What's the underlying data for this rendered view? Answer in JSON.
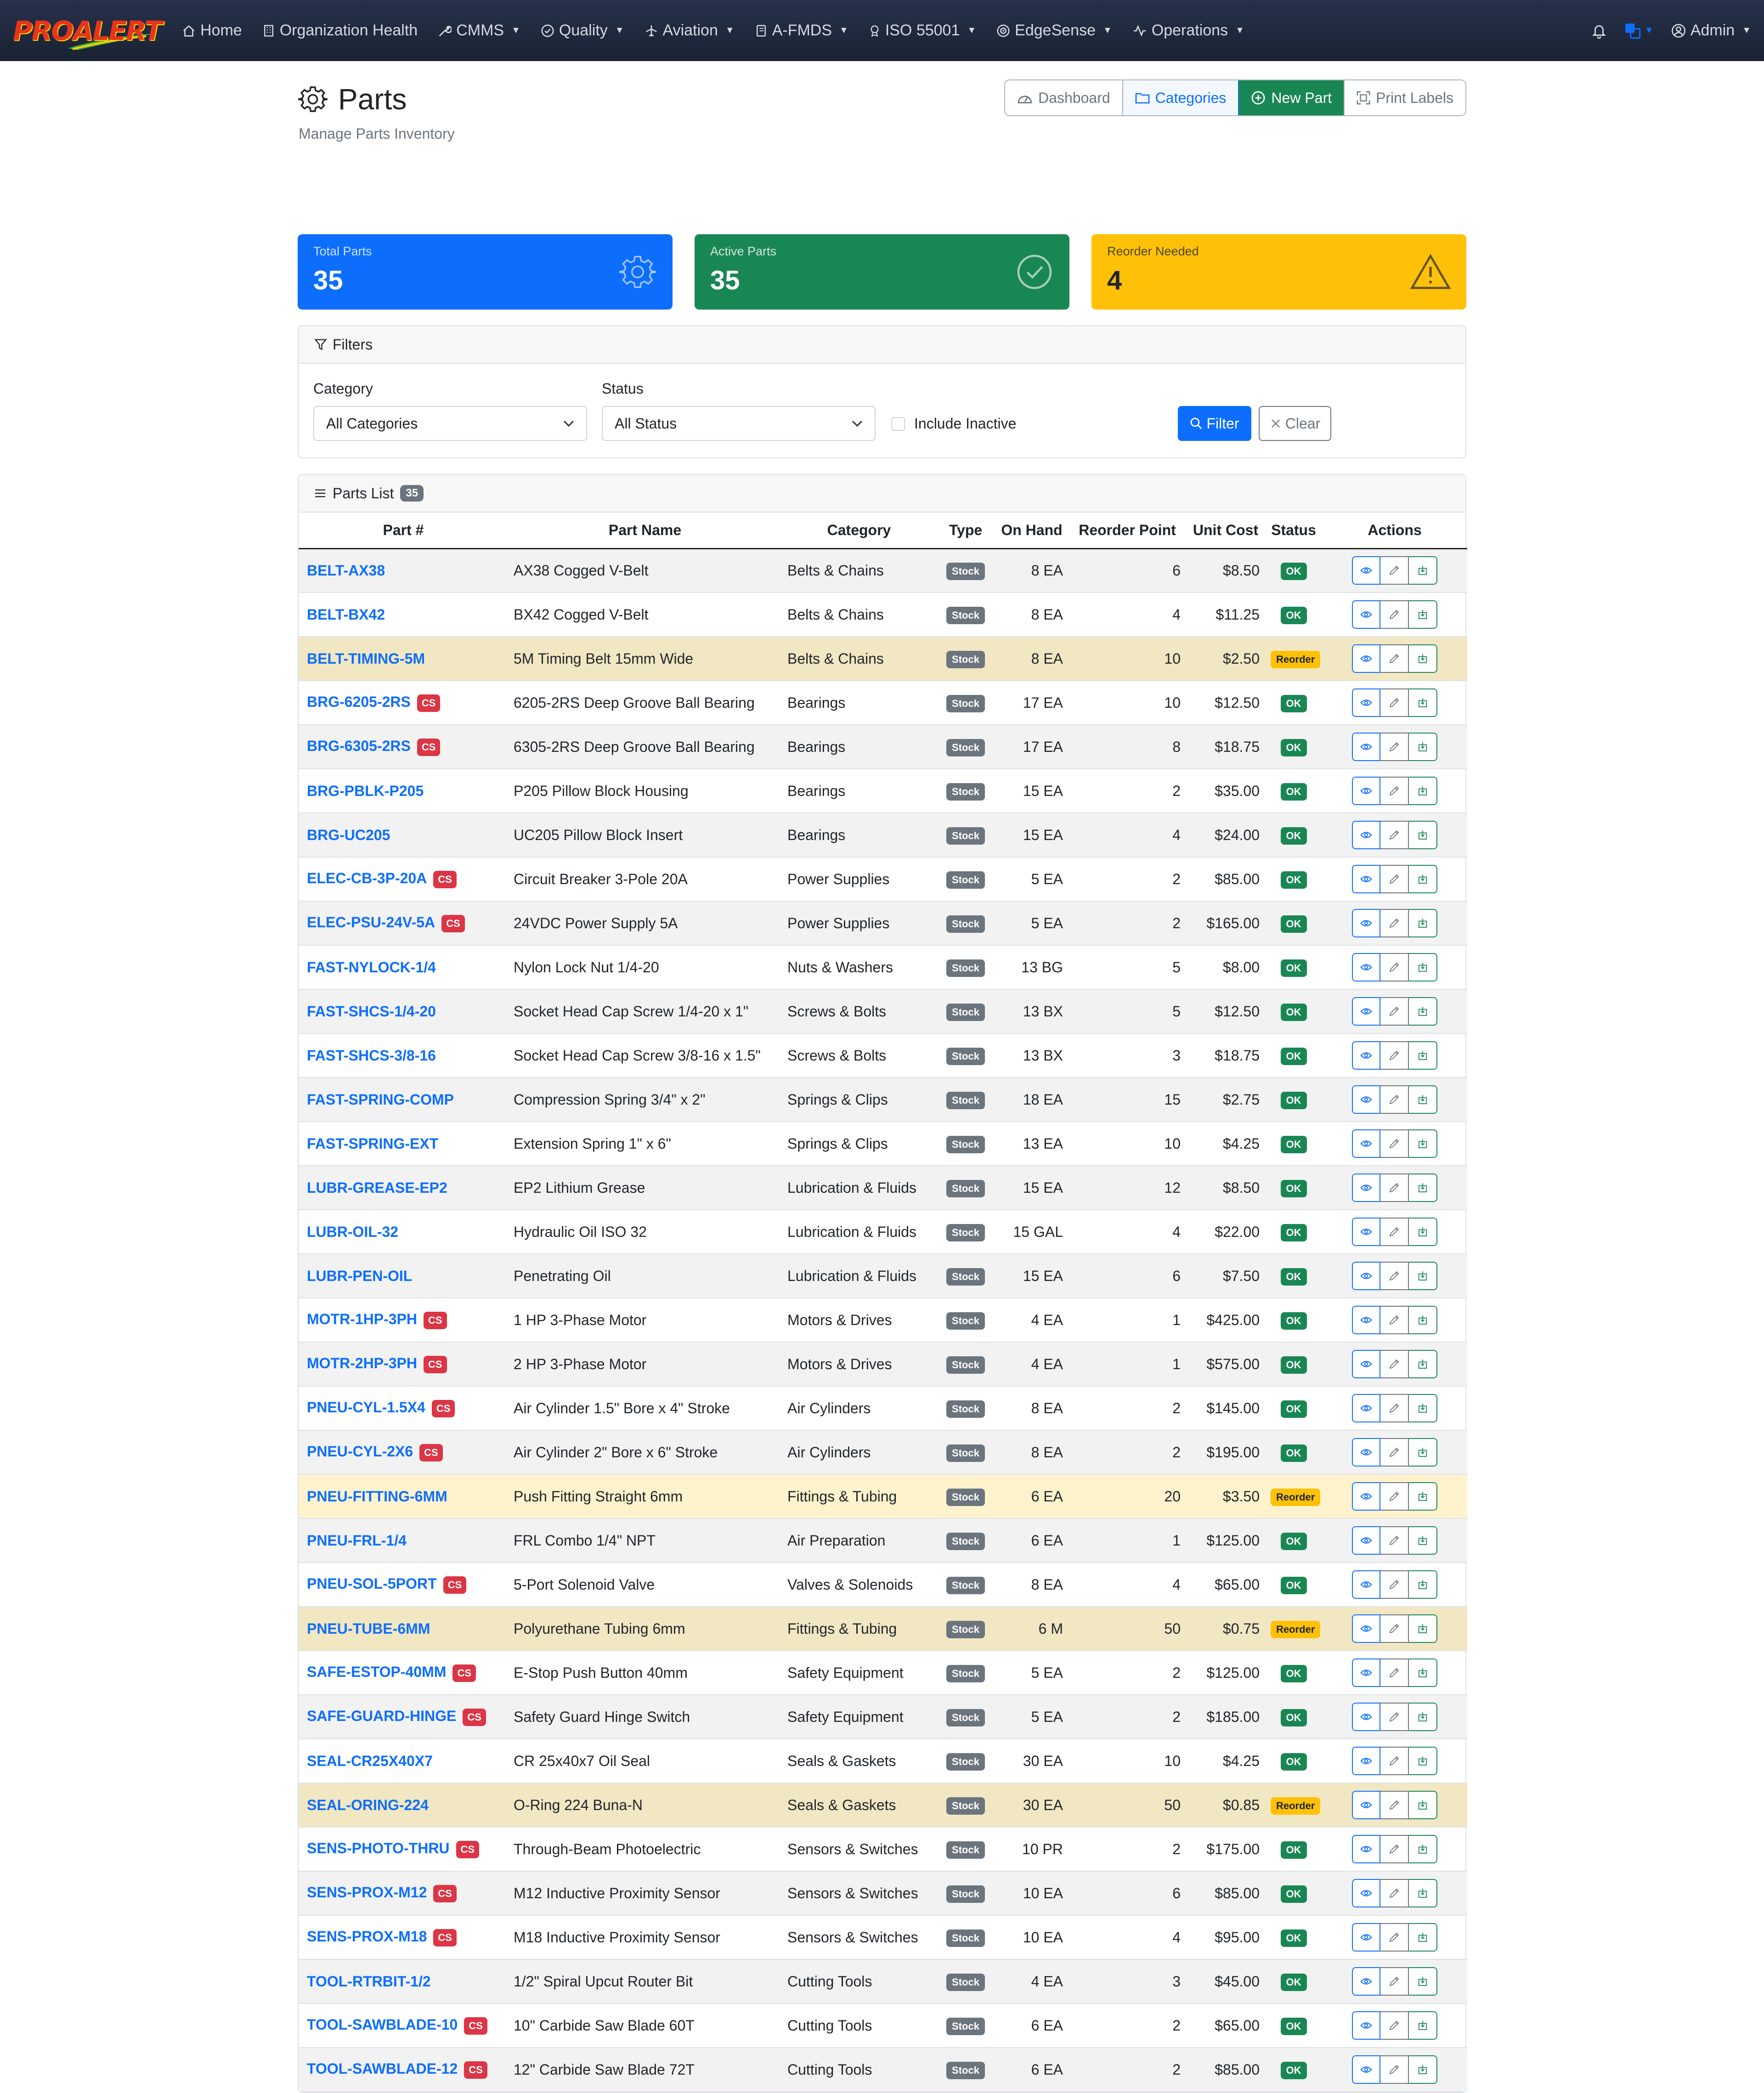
{
  "brand": {
    "name": "PROALERT"
  },
  "nav": {
    "items": [
      {
        "label": "Home",
        "icon": "house-icon",
        "dropdown": false
      },
      {
        "label": "Organization Health",
        "icon": "building-icon",
        "dropdown": false
      },
      {
        "label": "CMMS",
        "icon": "wrench-icon",
        "dropdown": true
      },
      {
        "label": "Quality",
        "icon": "check-circle-icon",
        "dropdown": true
      },
      {
        "label": "Aviation",
        "icon": "airplane-icon",
        "dropdown": true
      },
      {
        "label": "A-FMDS",
        "icon": "journal-icon",
        "dropdown": true
      },
      {
        "label": "ISO 55001",
        "icon": "award-icon",
        "dropdown": true
      },
      {
        "label": "EdgeSense",
        "icon": "broadcast-icon",
        "dropdown": true
      },
      {
        "label": "Operations",
        "icon": "activity-icon",
        "dropdown": true
      }
    ],
    "user_label": "Admin"
  },
  "page": {
    "title": "Parts",
    "subtitle": "Manage Parts Inventory",
    "buttons": {
      "dashboard": "Dashboard",
      "categories": "Categories",
      "new_part": "New Part",
      "print_labels": "Print Labels"
    }
  },
  "stats": {
    "total": {
      "label": "Total Parts",
      "value": "35"
    },
    "active": {
      "label": "Active Parts",
      "value": "35"
    },
    "reorder": {
      "label": "Reorder Needed",
      "value": "4"
    }
  },
  "filters": {
    "title": "Filters",
    "category_label": "Category",
    "category_value": "All Categories",
    "status_label": "Status",
    "status_value": "All Status",
    "include_inactive": "Include Inactive",
    "filter_btn": "Filter",
    "clear_btn": "Clear"
  },
  "parts_list": {
    "title": "Parts List",
    "count": "35",
    "columns": [
      "Part #",
      "Part Name",
      "Category",
      "Type",
      "On Hand",
      "Reorder Point",
      "Unit Cost",
      "Status",
      "Actions"
    ],
    "rows": [
      {
        "num": "BELT-AX38",
        "cs": false,
        "name": "AX38 Cogged V-Belt",
        "category": "Belts & Chains",
        "type": "Stock",
        "on_hand": "8 EA",
        "reorder": "6",
        "cost": "$8.50",
        "status": "OK"
      },
      {
        "num": "BELT-BX42",
        "cs": false,
        "name": "BX42 Cogged V-Belt",
        "category": "Belts & Chains",
        "type": "Stock",
        "on_hand": "8 EA",
        "reorder": "4",
        "cost": "$11.25",
        "status": "OK"
      },
      {
        "num": "BELT-TIMING-5M",
        "cs": false,
        "name": "5M Timing Belt 15mm Wide",
        "category": "Belts & Chains",
        "type": "Stock",
        "on_hand": "8 EA",
        "reorder": "10",
        "cost": "$2.50",
        "status": "Reorder"
      },
      {
        "num": "BRG-6205-2RS",
        "cs": true,
        "name": "6205-2RS Deep Groove Ball Bearing",
        "category": "Bearings",
        "type": "Stock",
        "on_hand": "17 EA",
        "reorder": "10",
        "cost": "$12.50",
        "status": "OK"
      },
      {
        "num": "BRG-6305-2RS",
        "cs": true,
        "name": "6305-2RS Deep Groove Ball Bearing",
        "category": "Bearings",
        "type": "Stock",
        "on_hand": "17 EA",
        "reorder": "8",
        "cost": "$18.75",
        "status": "OK"
      },
      {
        "num": "BRG-PBLK-P205",
        "cs": false,
        "name": "P205 Pillow Block Housing",
        "category": "Bearings",
        "type": "Stock",
        "on_hand": "15 EA",
        "reorder": "2",
        "cost": "$35.00",
        "status": "OK"
      },
      {
        "num": "BRG-UC205",
        "cs": false,
        "name": "UC205 Pillow Block Insert",
        "category": "Bearings",
        "type": "Stock",
        "on_hand": "15 EA",
        "reorder": "4",
        "cost": "$24.00",
        "status": "OK"
      },
      {
        "num": "ELEC-CB-3P-20A",
        "cs": true,
        "name": "Circuit Breaker 3-Pole 20A",
        "category": "Power Supplies",
        "type": "Stock",
        "on_hand": "5 EA",
        "reorder": "2",
        "cost": "$85.00",
        "status": "OK"
      },
      {
        "num": "ELEC-PSU-24V-5A",
        "cs": true,
        "name": "24VDC Power Supply 5A",
        "category": "Power Supplies",
        "type": "Stock",
        "on_hand": "5 EA",
        "reorder": "2",
        "cost": "$165.00",
        "status": "OK"
      },
      {
        "num": "FAST-NYLOCK-1/4",
        "cs": false,
        "name": "Nylon Lock Nut 1/4-20",
        "category": "Nuts & Washers",
        "type": "Stock",
        "on_hand": "13 BG",
        "reorder": "5",
        "cost": "$8.00",
        "status": "OK"
      },
      {
        "num": "FAST-SHCS-1/4-20",
        "cs": false,
        "name": "Socket Head Cap Screw 1/4-20 x 1\"",
        "category": "Screws & Bolts",
        "type": "Stock",
        "on_hand": "13 BX",
        "reorder": "5",
        "cost": "$12.50",
        "status": "OK"
      },
      {
        "num": "FAST-SHCS-3/8-16",
        "cs": false,
        "name": "Socket Head Cap Screw 3/8-16 x 1.5\"",
        "category": "Screws & Bolts",
        "type": "Stock",
        "on_hand": "13 BX",
        "reorder": "3",
        "cost": "$18.75",
        "status": "OK"
      },
      {
        "num": "FAST-SPRING-COMP",
        "cs": false,
        "name": "Compression Spring 3/4\" x 2\"",
        "category": "Springs & Clips",
        "type": "Stock",
        "on_hand": "18 EA",
        "reorder": "15",
        "cost": "$2.75",
        "status": "OK"
      },
      {
        "num": "FAST-SPRING-EXT",
        "cs": false,
        "name": "Extension Spring 1\" x 6\"",
        "category": "Springs & Clips",
        "type": "Stock",
        "on_hand": "13 EA",
        "reorder": "10",
        "cost": "$4.25",
        "status": "OK"
      },
      {
        "num": "LUBR-GREASE-EP2",
        "cs": false,
        "name": "EP2 Lithium Grease",
        "category": "Lubrication & Fluids",
        "type": "Stock",
        "on_hand": "15 EA",
        "reorder": "12",
        "cost": "$8.50",
        "status": "OK"
      },
      {
        "num": "LUBR-OIL-32",
        "cs": false,
        "name": "Hydraulic Oil ISO 32",
        "category": "Lubrication & Fluids",
        "type": "Stock",
        "on_hand": "15 GAL",
        "reorder": "4",
        "cost": "$22.00",
        "status": "OK"
      },
      {
        "num": "LUBR-PEN-OIL",
        "cs": false,
        "name": "Penetrating Oil",
        "category": "Lubrication & Fluids",
        "type": "Stock",
        "on_hand": "15 EA",
        "reorder": "6",
        "cost": "$7.50",
        "status": "OK"
      },
      {
        "num": "MOTR-1HP-3PH",
        "cs": true,
        "name": "1 HP 3-Phase Motor",
        "category": "Motors & Drives",
        "type": "Stock",
        "on_hand": "4 EA",
        "reorder": "1",
        "cost": "$425.00",
        "status": "OK"
      },
      {
        "num": "MOTR-2HP-3PH",
        "cs": true,
        "name": "2 HP 3-Phase Motor",
        "category": "Motors & Drives",
        "type": "Stock",
        "on_hand": "4 EA",
        "reorder": "1",
        "cost": "$575.00",
        "status": "OK"
      },
      {
        "num": "PNEU-CYL-1.5X4",
        "cs": true,
        "name": "Air Cylinder 1.5\" Bore x 4\" Stroke",
        "category": "Air Cylinders",
        "type": "Stock",
        "on_hand": "8 EA",
        "reorder": "2",
        "cost": "$145.00",
        "status": "OK"
      },
      {
        "num": "PNEU-CYL-2X6",
        "cs": true,
        "name": "Air Cylinder 2\" Bore x 6\" Stroke",
        "category": "Air Cylinders",
        "type": "Stock",
        "on_hand": "8 EA",
        "reorder": "2",
        "cost": "$195.00",
        "status": "OK"
      },
      {
        "num": "PNEU-FITTING-6MM",
        "cs": false,
        "name": "Push Fitting Straight 6mm",
        "category": "Fittings & Tubing",
        "type": "Stock",
        "on_hand": "6 EA",
        "reorder": "20",
        "cost": "$3.50",
        "status": "Reorder"
      },
      {
        "num": "PNEU-FRL-1/4",
        "cs": false,
        "name": "FRL Combo 1/4\" NPT",
        "category": "Air Preparation",
        "type": "Stock",
        "on_hand": "6 EA",
        "reorder": "1",
        "cost": "$125.00",
        "status": "OK"
      },
      {
        "num": "PNEU-SOL-5PORT",
        "cs": true,
        "name": "5-Port Solenoid Valve",
        "category": "Valves & Solenoids",
        "type": "Stock",
        "on_hand": "8 EA",
        "reorder": "4",
        "cost": "$65.00",
        "status": "OK"
      },
      {
        "num": "PNEU-TUBE-6MM",
        "cs": false,
        "name": "Polyurethane Tubing 6mm",
        "category": "Fittings & Tubing",
        "type": "Stock",
        "on_hand": "6 M",
        "reorder": "50",
        "cost": "$0.75",
        "status": "Reorder"
      },
      {
        "num": "SAFE-ESTOP-40MM",
        "cs": true,
        "name": "E-Stop Push Button 40mm",
        "category": "Safety Equipment",
        "type": "Stock",
        "on_hand": "5 EA",
        "reorder": "2",
        "cost": "$125.00",
        "status": "OK"
      },
      {
        "num": "SAFE-GUARD-HINGE",
        "cs": true,
        "name": "Safety Guard Hinge Switch",
        "category": "Safety Equipment",
        "type": "Stock",
        "on_hand": "5 EA",
        "reorder": "2",
        "cost": "$185.00",
        "status": "OK"
      },
      {
        "num": "SEAL-CR25X40X7",
        "cs": false,
        "name": "CR 25x40x7 Oil Seal",
        "category": "Seals & Gaskets",
        "type": "Stock",
        "on_hand": "30 EA",
        "reorder": "10",
        "cost": "$4.25",
        "status": "OK"
      },
      {
        "num": "SEAL-ORING-224",
        "cs": false,
        "name": "O-Ring 224 Buna-N",
        "category": "Seals & Gaskets",
        "type": "Stock",
        "on_hand": "30 EA",
        "reorder": "50",
        "cost": "$0.85",
        "status": "Reorder"
      },
      {
        "num": "SENS-PHOTO-THRU",
        "cs": true,
        "name": "Through-Beam Photoelectric",
        "category": "Sensors & Switches",
        "type": "Stock",
        "on_hand": "10 PR",
        "reorder": "2",
        "cost": "$175.00",
        "status": "OK"
      },
      {
        "num": "SENS-PROX-M12",
        "cs": true,
        "name": "M12 Inductive Proximity Sensor",
        "category": "Sensors & Switches",
        "type": "Stock",
        "on_hand": "10 EA",
        "reorder": "6",
        "cost": "$85.00",
        "status": "OK"
      },
      {
        "num": "SENS-PROX-M18",
        "cs": true,
        "name": "M18 Inductive Proximity Sensor",
        "category": "Sensors & Switches",
        "type": "Stock",
        "on_hand": "10 EA",
        "reorder": "4",
        "cost": "$95.00",
        "status": "OK"
      },
      {
        "num": "TOOL-RTRBIT-1/2",
        "cs": false,
        "name": "1/2\" Spiral Upcut Router Bit",
        "category": "Cutting Tools",
        "type": "Stock",
        "on_hand": "4 EA",
        "reorder": "3",
        "cost": "$45.00",
        "status": "OK"
      },
      {
        "num": "TOOL-SAWBLADE-10",
        "cs": true,
        "name": "10\" Carbide Saw Blade 60T",
        "category": "Cutting Tools",
        "type": "Stock",
        "on_hand": "6 EA",
        "reorder": "2",
        "cost": "$65.00",
        "status": "OK"
      },
      {
        "num": "TOOL-SAWBLADE-12",
        "cs": true,
        "name": "12\" Carbide Saw Blade 72T",
        "category": "Cutting Tools",
        "type": "Stock",
        "on_hand": "6 EA",
        "reorder": "2",
        "cost": "$85.00",
        "status": "OK"
      }
    ],
    "cs_label": "CS"
  },
  "colors": {
    "primary": "#0d6efd",
    "success": "#198754",
    "warning": "#ffc107",
    "danger": "#dc3545",
    "secondary": "#6c757d",
    "navbar": "#1e2638"
  }
}
